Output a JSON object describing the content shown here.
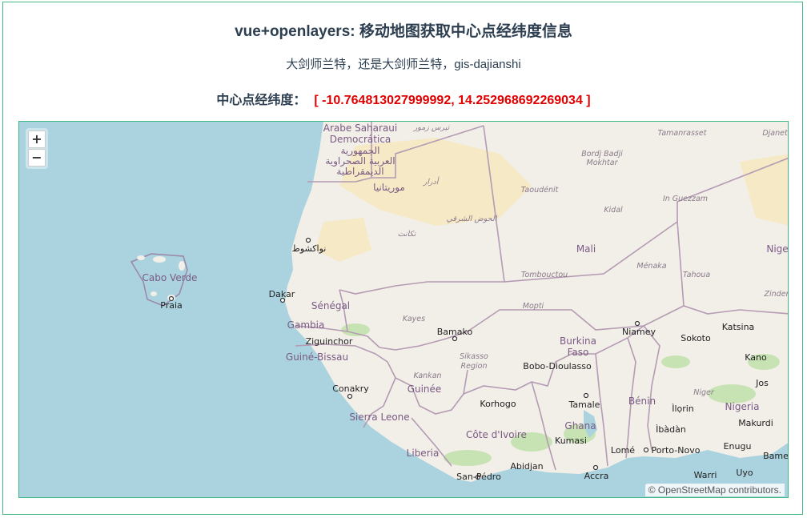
{
  "page": {
    "title": "vue+openlayers: 移动地图获取中心点经纬度信息",
    "subtitle": "大剑师兰特，还是大剑师兰特，gis-dajianshi",
    "center_label": "中心点经纬度：",
    "center_value": "[ -10.764813027999992, 14.252968692269034 ]"
  },
  "map": {
    "zoom_in": "+",
    "zoom_out": "−",
    "attribution_symbol": "©",
    "attribution_link": "OpenStreetMap",
    "attribution_suffix": "contributors.",
    "countries": {
      "western_sahara_1": "Arabe Saharaui",
      "western_sahara_2": "Democrática",
      "western_sahara_ar1": "الجمهورية",
      "western_sahara_ar2": "العربية الصحراوية",
      "western_sahara_ar3": "الديمقراطية",
      "mauritania": "موريتانيا",
      "mali": "Mali",
      "cabo_verde": "Cabo Verde",
      "senegal": "Sénégal",
      "gambia": "Gambia",
      "guinee_bissau": "Guiné-Bissau",
      "guinee": "Guinée",
      "sierra_leone": "Sierra Leone",
      "liberia": "Liberia",
      "cote_divoire": "Côte d'Ivoire",
      "burkina_1": "Burkina",
      "burkina_2": "Faso",
      "ghana": "Ghana",
      "benin": "Bénin",
      "nigeria": "Nigeria",
      "niger": "Nige"
    },
    "cities": {
      "nouakchott": "نواكشوط",
      "praia": "Praia",
      "dakar": "Dakar",
      "ziguinchor": "Ziguinchor",
      "bamako": "Bamako",
      "conakry": "Conakry",
      "niamey": "Niamey",
      "bobo": "Bobo-Dioulasso",
      "korhogo": "Korhogo",
      "tamale": "Tamale",
      "kumasi": "Kumasi",
      "abidjan": "Abidjan",
      "accra": "Accra",
      "lome": "Lomé",
      "porto_novo": "Porto-Novo",
      "san_pedro": "San-Pédro",
      "katsina": "Katsina",
      "sokoto": "Sokoto",
      "kano": "Kano",
      "jos": "Jos",
      "ilorin": "Ìlọrin",
      "ibadan": "Ìbàdàn",
      "makurdi": "Makurdi",
      "enugu": "Enugu",
      "uyo": "Uyo",
      "warri": "Warri",
      "bame": "Bame"
    },
    "regions": {
      "tiris": "تيرس زمور",
      "adrar": "أدرار",
      "hodh": "الحوض الشرقي",
      "tagant": "تكانت",
      "tamanrasset": "Tamanrasset",
      "djanet": "Djanet",
      "bordj_1": "Bordj Badji",
      "bordj_2": "Mokhtar",
      "taoudenit": "Taoudénit",
      "in_guezzam": "In Guezzam",
      "kidal": "Kidal",
      "menaka": "Ménaka",
      "tombouctou": "Tombouctou",
      "tahoua": "Tahoua",
      "zinder": "Zinder",
      "mopti": "Mopti",
      "kayes": "Kayes",
      "sikasso_1": "Sikasso",
      "sikasso_2": "Region",
      "kankan": "Kankan",
      "niger_river": "Niger"
    }
  }
}
